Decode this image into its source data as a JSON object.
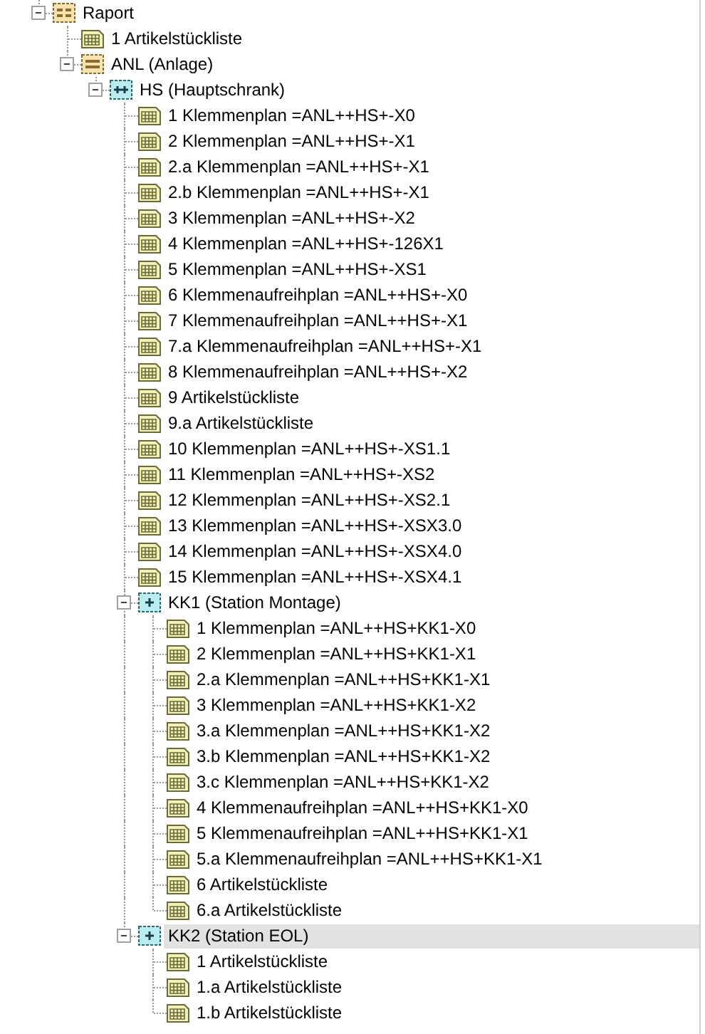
{
  "tree": [
    {
      "label": "Raport",
      "kind": "report",
      "expanded": true,
      "selected": false,
      "children": [
        {
          "label": "1 Artikelstückliste",
          "kind": "sheet",
          "selected": false
        },
        {
          "label": "ANL (Anlage)",
          "kind": "group",
          "expanded": true,
          "selected": false,
          "children": [
            {
              "label": "HS (Hauptschrank)",
              "kind": "cabinet",
              "expanded": true,
              "selected": false,
              "children": [
                {
                  "label": "1 Klemmenplan =ANL++HS+-X0",
                  "kind": "sheet",
                  "selected": false
                },
                {
                  "label": "2 Klemmenplan =ANL++HS+-X1",
                  "kind": "sheet",
                  "selected": false
                },
                {
                  "label": "2.a Klemmenplan =ANL++HS+-X1",
                  "kind": "sheet",
                  "selected": false
                },
                {
                  "label": "2.b Klemmenplan =ANL++HS+-X1",
                  "kind": "sheet",
                  "selected": false
                },
                {
                  "label": "3 Klemmenplan =ANL++HS+-X2",
                  "kind": "sheet",
                  "selected": false
                },
                {
                  "label": "4 Klemmenplan =ANL++HS+-126X1",
                  "kind": "sheet",
                  "selected": false
                },
                {
                  "label": "5 Klemmenplan =ANL++HS+-XS1",
                  "kind": "sheet",
                  "selected": false
                },
                {
                  "label": "6 Klemmenaufreihplan =ANL++HS+-X0",
                  "kind": "sheet",
                  "selected": false
                },
                {
                  "label": "7 Klemmenaufreihplan =ANL++HS+-X1",
                  "kind": "sheet",
                  "selected": false
                },
                {
                  "label": "7.a Klemmenaufreihplan =ANL++HS+-X1",
                  "kind": "sheet",
                  "selected": false
                },
                {
                  "label": "8 Klemmenaufreihplan =ANL++HS+-X2",
                  "kind": "sheet",
                  "selected": false
                },
                {
                  "label": "9 Artikelstückliste",
                  "kind": "sheet",
                  "selected": false
                },
                {
                  "label": "9.a Artikelstückliste",
                  "kind": "sheet",
                  "selected": false
                },
                {
                  "label": "10 Klemmenplan =ANL++HS+-XS1.1",
                  "kind": "sheet",
                  "selected": false
                },
                {
                  "label": "11 Klemmenplan =ANL++HS+-XS2",
                  "kind": "sheet",
                  "selected": false
                },
                {
                  "label": "12 Klemmenplan =ANL++HS+-XS2.1",
                  "kind": "sheet",
                  "selected": false
                },
                {
                  "label": "13 Klemmenplan =ANL++HS+-XSX3.0",
                  "kind": "sheet",
                  "selected": false
                },
                {
                  "label": "14 Klemmenplan =ANL++HS+-XSX4.0",
                  "kind": "sheet",
                  "selected": false
                },
                {
                  "label": "15 Klemmenplan =ANL++HS+-XSX4.1",
                  "kind": "sheet",
                  "selected": false
                },
                {
                  "label": "KK1 (Station Montage)",
                  "kind": "station",
                  "expanded": true,
                  "selected": false,
                  "children": [
                    {
                      "label": "1 Klemmenplan =ANL++HS+KK1-X0",
                      "kind": "sheet",
                      "selected": false
                    },
                    {
                      "label": "2 Klemmenplan =ANL++HS+KK1-X1",
                      "kind": "sheet",
                      "selected": false
                    },
                    {
                      "label": "2.a Klemmenplan =ANL++HS+KK1-X1",
                      "kind": "sheet",
                      "selected": false
                    },
                    {
                      "label": "3 Klemmenplan =ANL++HS+KK1-X2",
                      "kind": "sheet",
                      "selected": false
                    },
                    {
                      "label": "3.a Klemmenplan =ANL++HS+KK1-X2",
                      "kind": "sheet",
                      "selected": false
                    },
                    {
                      "label": "3.b Klemmenplan =ANL++HS+KK1-X2",
                      "kind": "sheet",
                      "selected": false
                    },
                    {
                      "label": "3.c Klemmenplan =ANL++HS+KK1-X2",
                      "kind": "sheet",
                      "selected": false
                    },
                    {
                      "label": "4 Klemmenaufreihplan =ANL++HS+KK1-X0",
                      "kind": "sheet",
                      "selected": false
                    },
                    {
                      "label": "5 Klemmenaufreihplan =ANL++HS+KK1-X1",
                      "kind": "sheet",
                      "selected": false
                    },
                    {
                      "label": "5.a Klemmenaufreihplan =ANL++HS+KK1-X1",
                      "kind": "sheet",
                      "selected": false
                    },
                    {
                      "label": "6 Artikelstückliste",
                      "kind": "sheet",
                      "selected": false
                    },
                    {
                      "label": "6.a Artikelstückliste",
                      "kind": "sheet",
                      "selected": false
                    }
                  ]
                },
                {
                  "label": "KK2 (Station EOL)",
                  "kind": "station",
                  "expanded": true,
                  "selected": true,
                  "children": [
                    {
                      "label": "1 Artikelstückliste",
                      "kind": "sheet",
                      "selected": false
                    },
                    {
                      "label": "1.a Artikelstückliste",
                      "kind": "sheet",
                      "selected": false
                    },
                    {
                      "label": "1.b Artikelstückliste",
                      "kind": "sheet",
                      "selected": false
                    }
                  ]
                }
              ]
            }
          ]
        }
      ]
    }
  ]
}
